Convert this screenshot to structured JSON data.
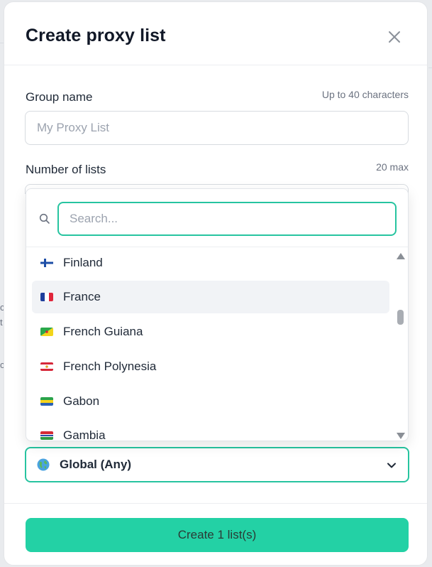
{
  "background": {
    "fragments": [
      "c",
      "t",
      "c"
    ]
  },
  "modal": {
    "title": "Create proxy list",
    "group_name": {
      "label": "Group name",
      "hint": "Up to 40 characters",
      "placeholder": "My Proxy List",
      "value": ""
    },
    "number_of_lists": {
      "label": "Number of lists",
      "hint": "20 max"
    },
    "country_dropdown": {
      "search_placeholder": "Search...",
      "items": [
        {
          "name": "Finland",
          "selected": false
        },
        {
          "name": "France",
          "selected": true
        },
        {
          "name": "French Guiana",
          "selected": false
        },
        {
          "name": "French Polynesia",
          "selected": false
        },
        {
          "name": "Gabon",
          "selected": false
        },
        {
          "name": "Gambia",
          "selected": false
        }
      ],
      "scroll_position": 0.3
    },
    "location": {
      "value": "Global (Any)",
      "icon": "globe-icon"
    },
    "create_button": "Create 1 list(s)"
  },
  "colors": {
    "accent": "#27c4a0",
    "button": "#23d1a5",
    "selected_row": "#f1f3f6"
  }
}
